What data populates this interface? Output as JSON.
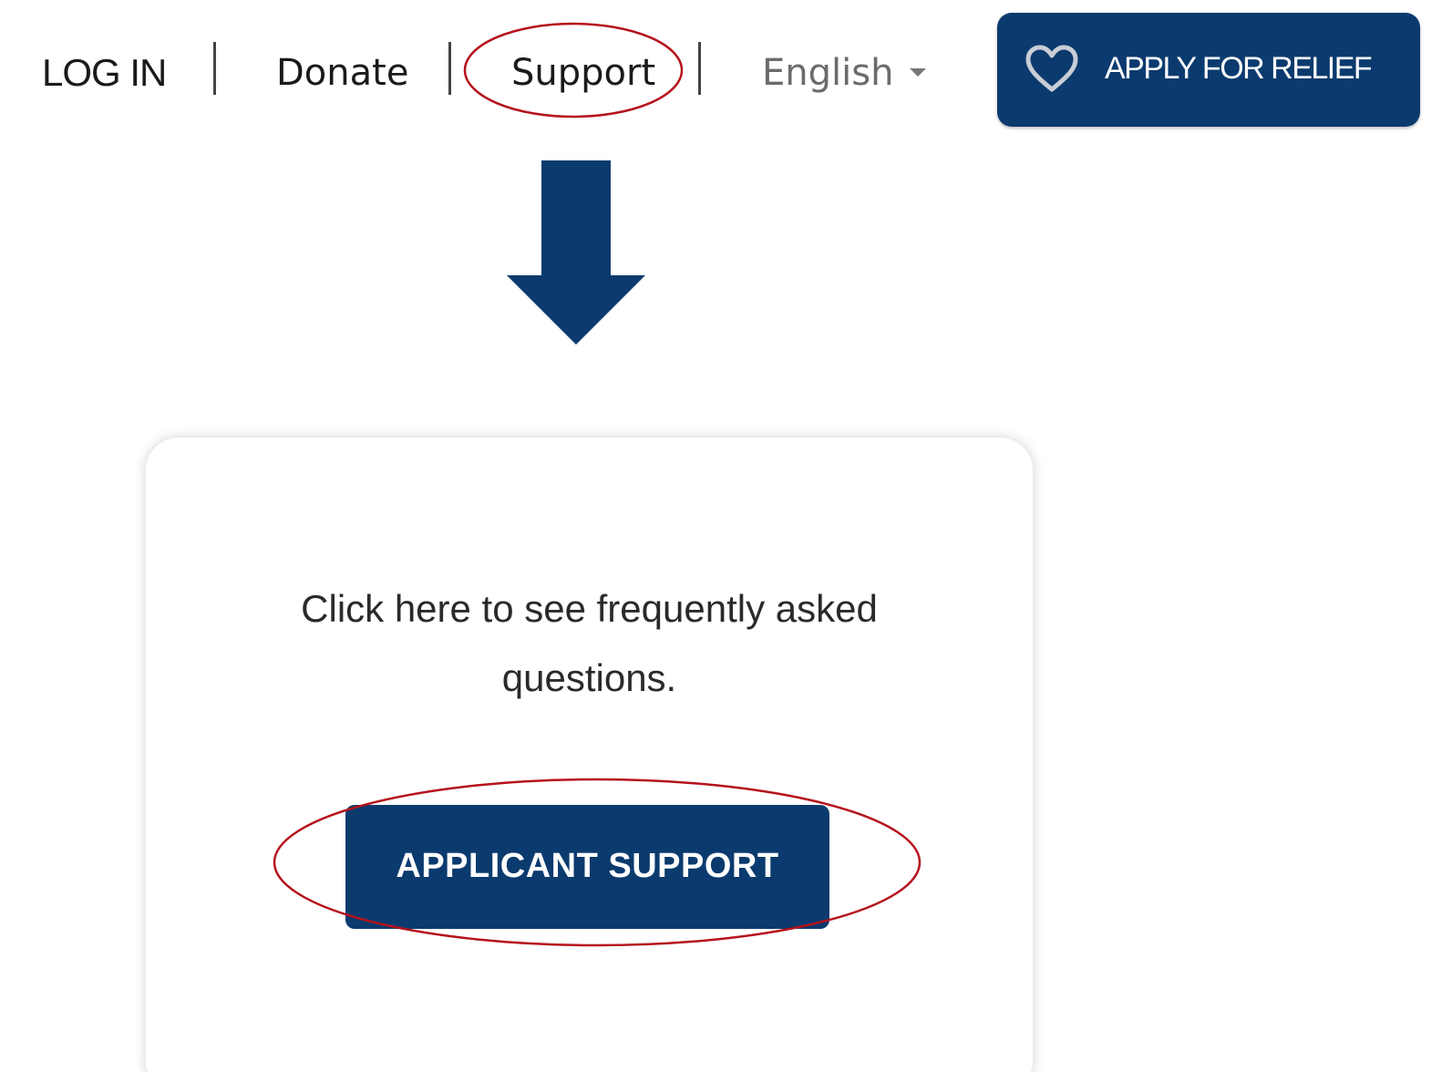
{
  "nav": {
    "login_label": "LOG IN",
    "donate_label": "Donate",
    "support_label": "Support",
    "language_label": "English",
    "language_caret_icon": "caret-down-icon",
    "apply_label": "APPLY FOR RELIEF",
    "apply_icon": "heart-icon"
  },
  "annotations": {
    "arrow_icon": "down-arrow-icon",
    "highlight_color": "#b5121b"
  },
  "card": {
    "faq_text": "Click here to see frequently asked questions.",
    "button_label": "APPLICANT SUPPORT"
  },
  "colors": {
    "brand_navy": "#0b3a6e",
    "text_dark": "#1a1a1a",
    "text_muted": "#6b6b6b"
  }
}
